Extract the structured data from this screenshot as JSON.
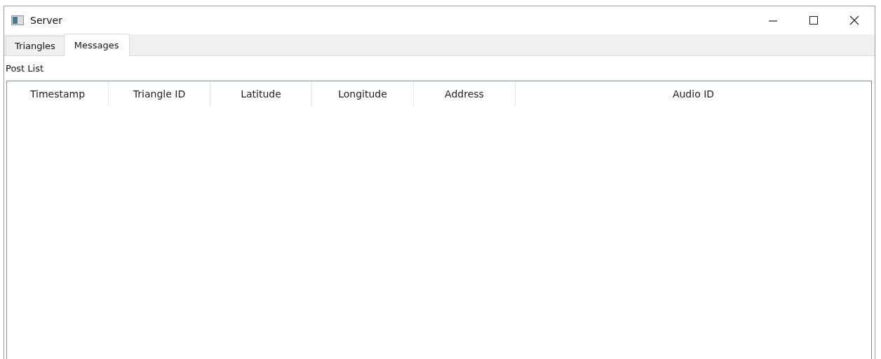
{
  "window": {
    "title": "Server"
  },
  "tabs": [
    {
      "label": "Triangles",
      "selected": false
    },
    {
      "label": "Messages",
      "selected": true
    }
  ],
  "section_label": "Post List",
  "table": {
    "columns": [
      "Timestamp",
      "Triangle ID",
      "Latitude",
      "Longitude",
      "Address",
      "Audio ID"
    ]
  }
}
